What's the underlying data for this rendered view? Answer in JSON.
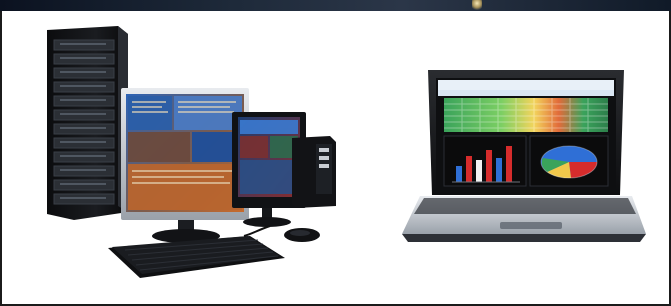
{
  "image": {
    "description_label": "desktop-workstation-and-laptop-photo",
    "colors": {
      "background": "#ffffff",
      "border": "#1b1b1b",
      "device_black": "#101214",
      "device_silver": "#c9cdd3",
      "screen_blue": "#2d5fa8",
      "screen_orange": "#c26a2a",
      "spreadsheet_green": "#2e8b57",
      "chart_red": "#d62c2c",
      "chart_blue": "#2f6fd6"
    }
  }
}
